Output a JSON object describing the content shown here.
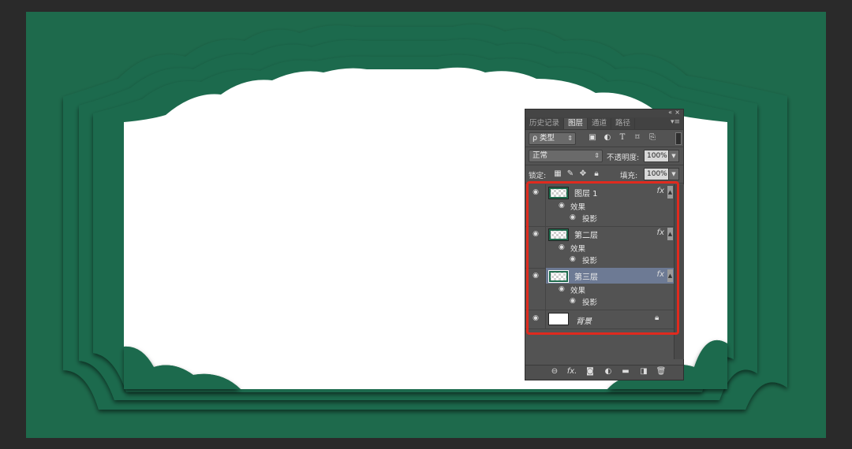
{
  "colors": {
    "background": "#2a2a2a",
    "canvas_green": "#1e6a4c",
    "paper_white": "#ffffff",
    "panel_bg": "#535353",
    "selected_row": "#6d7a94",
    "highlight": "#e02a1e"
  },
  "panel": {
    "collapse_icons": [
      "«",
      "×"
    ],
    "tabs": [
      "历史记录",
      "图层",
      "通道",
      "路径"
    ],
    "active_tab": "图层",
    "tab_menu_icon": "menu-icon",
    "filter": {
      "kind_label": "ρ 类型",
      "arrow": "⇕",
      "icons": [
        "image-filter-icon",
        "adjust-filter-icon",
        "type-filter-icon",
        "shape-filter-icon",
        "smart-filter-icon"
      ]
    },
    "blend_mode": "正常",
    "opacity_label": "不透明度:",
    "opacity_value": "100%",
    "lock_label": "锁定:",
    "fill_label": "填充:",
    "fill_value": "100%",
    "layers": [
      {
        "name": "图层 1",
        "effects_label": "效果",
        "effect": "投影",
        "fx": "fx",
        "selected": false
      },
      {
        "name": "第二层",
        "effects_label": "效果",
        "effect": "投影",
        "fx": "fx",
        "selected": false
      },
      {
        "name": "第三层",
        "effects_label": "效果",
        "effect": "投影",
        "fx": "fx",
        "selected": true
      }
    ],
    "background_layer": {
      "name": "背景",
      "lock_icon": "lock-icon"
    },
    "bottom_icons": [
      "link-icon",
      "fx-icon",
      "mask-icon",
      "adjustment-icon",
      "folder-icon",
      "new-layer-icon",
      "trash-icon"
    ],
    "bottom_fx": "fx."
  }
}
